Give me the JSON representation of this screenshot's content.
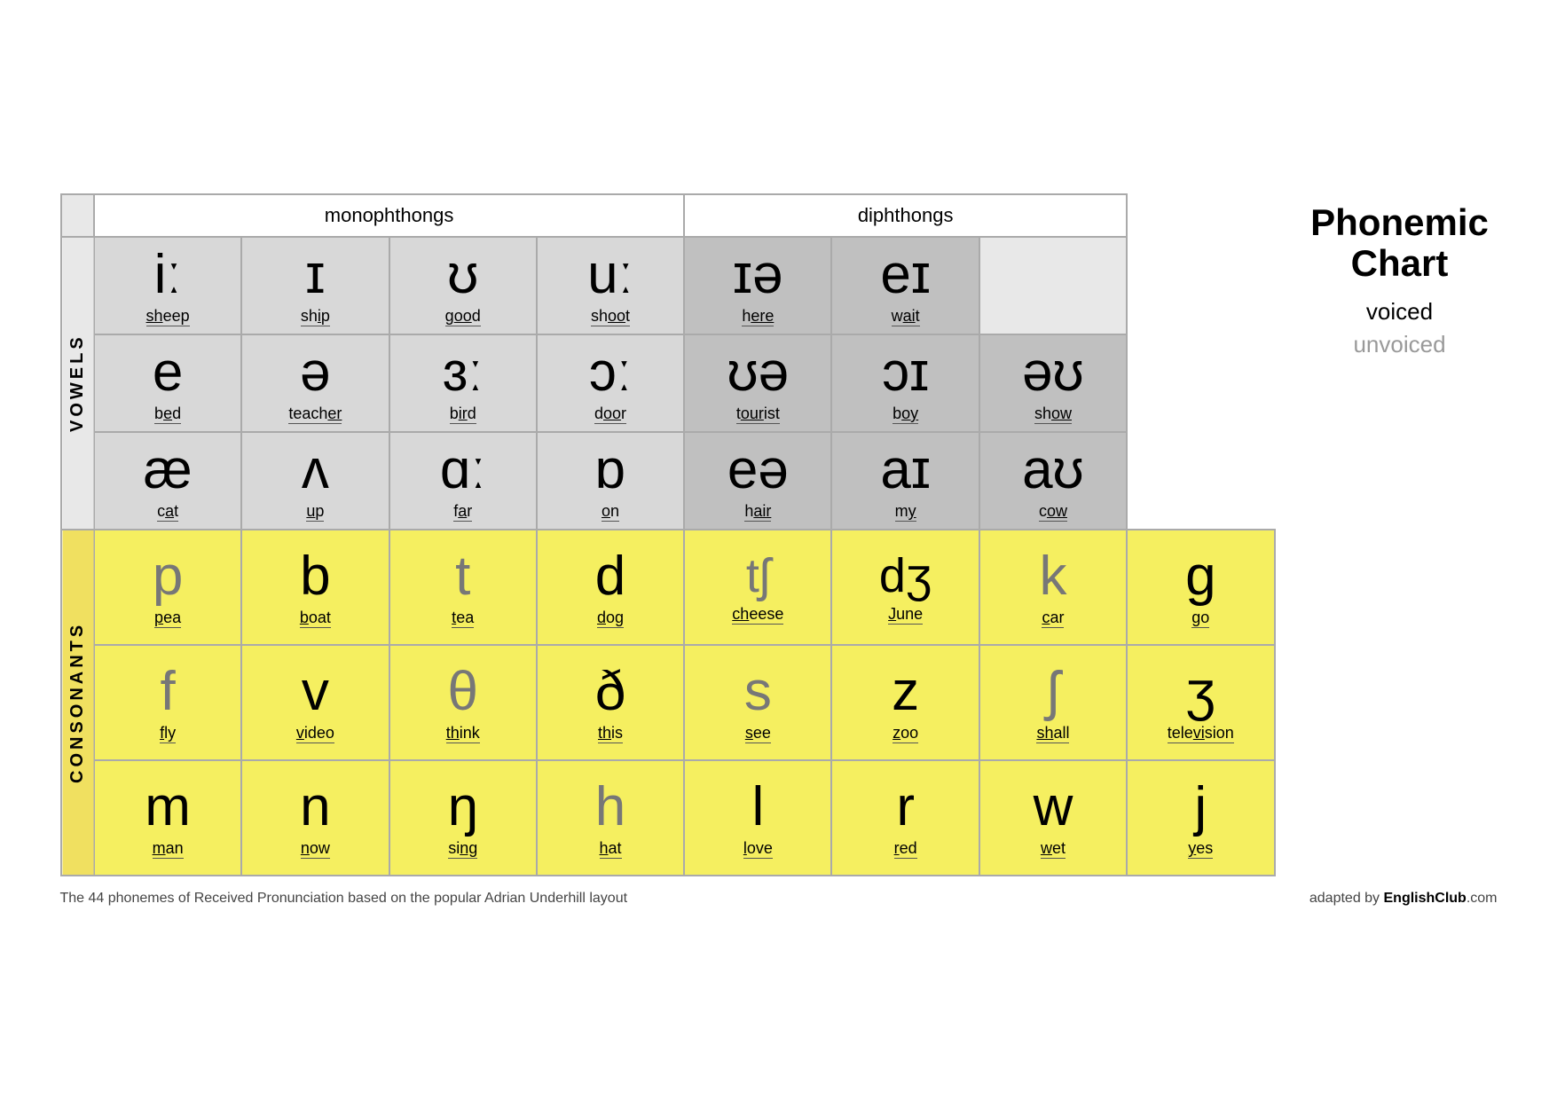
{
  "title": {
    "line1": "Phonemic",
    "line2": "Chart",
    "voiced": "voiced",
    "unvoiced": "unvoiced"
  },
  "headers": {
    "monophthongs": "monophthongs",
    "diphthongs": "diphthongs"
  },
  "section_labels": {
    "vowels": "VOWELS",
    "consonants": "CONSONANTS"
  },
  "vowel_rows": [
    {
      "cells": [
        {
          "symbol": "iː",
          "word": "sheep",
          "underline": "ee"
        },
        {
          "symbol": "ɪ",
          "word": "ship",
          "underline": "i"
        },
        {
          "symbol": "ʊ",
          "word": "good",
          "underline": "oo"
        },
        {
          "symbol": "uː",
          "word": "shoot",
          "underline": "oo"
        }
      ],
      "diphthong_cells": [
        {
          "symbol": "ɪə",
          "word": "here",
          "underline": "ere"
        },
        {
          "symbol": "eɪ",
          "word": "wait",
          "underline": "ai"
        }
      ]
    },
    {
      "cells": [
        {
          "symbol": "e",
          "word": "bed",
          "underline": "e"
        },
        {
          "symbol": "ə",
          "word": "teacher",
          "underline": "er"
        },
        {
          "symbol": "ɜː",
          "word": "bird",
          "underline": "ir"
        },
        {
          "symbol": "ɔː",
          "word": "door",
          "underline": "oo"
        }
      ],
      "diphthong_cells": [
        {
          "symbol": "ʊə",
          "word": "tourist",
          "underline": "our"
        },
        {
          "symbol": "ɔɪ",
          "word": "boy",
          "underline": "oy"
        },
        {
          "symbol": "əʊ",
          "word": "show",
          "underline": "ow"
        }
      ]
    },
    {
      "cells": [
        {
          "symbol": "æ",
          "word": "cat",
          "underline": "a"
        },
        {
          "symbol": "ʌ",
          "word": "up",
          "underline": "u"
        },
        {
          "symbol": "ɑː",
          "word": "far",
          "underline": "a"
        },
        {
          "symbol": "ɒ",
          "word": "on",
          "underline": "o"
        }
      ],
      "diphthong_cells": [
        {
          "symbol": "eə",
          "word": "hair",
          "underline": "air"
        },
        {
          "symbol": "aɪ",
          "word": "my",
          "underline": "y"
        },
        {
          "symbol": "aʊ",
          "word": "cow",
          "underline": "ow"
        }
      ]
    }
  ],
  "consonant_rows": [
    {
      "cells": [
        {
          "symbol": "p",
          "word": "pea",
          "underline": "p",
          "voiced": false
        },
        {
          "symbol": "b",
          "word": "boat",
          "underline": "b",
          "voiced": true
        },
        {
          "symbol": "t",
          "word": "tea",
          "underline": "t",
          "voiced": false
        },
        {
          "symbol": "d",
          "word": "dog",
          "underline": "d",
          "voiced": true
        },
        {
          "symbol": "tʃ",
          "word": "cheese",
          "underline": "ch",
          "voiced": false
        },
        {
          "symbol": "dʒ",
          "word": "June",
          "underline": "J",
          "voiced": true
        },
        {
          "symbol": "k",
          "word": "car",
          "underline": "c",
          "voiced": false
        },
        {
          "symbol": "g",
          "word": "go",
          "underline": "g",
          "voiced": true
        }
      ]
    },
    {
      "cells": [
        {
          "symbol": "f",
          "word": "fly",
          "underline": "f",
          "voiced": false
        },
        {
          "symbol": "v",
          "word": "video",
          "underline": "v",
          "voiced": true
        },
        {
          "symbol": "θ",
          "word": "think",
          "underline": "th",
          "voiced": false
        },
        {
          "symbol": "ð",
          "word": "this",
          "underline": "th",
          "voiced": true
        },
        {
          "symbol": "s",
          "word": "see",
          "underline": "s",
          "voiced": false
        },
        {
          "symbol": "z",
          "word": "zoo",
          "underline": "z",
          "voiced": true
        },
        {
          "symbol": "ʃ",
          "word": "shall",
          "underline": "sh",
          "voiced": false
        },
        {
          "symbol": "ʒ",
          "word": "television",
          "underline": "si",
          "voiced": true
        }
      ]
    },
    {
      "cells": [
        {
          "symbol": "m",
          "word": "man",
          "underline": "m",
          "voiced": true
        },
        {
          "symbol": "n",
          "word": "now",
          "underline": "n",
          "voiced": true
        },
        {
          "symbol": "ŋ",
          "word": "sing",
          "underline": "ng",
          "voiced": true
        },
        {
          "symbol": "h",
          "word": "hat",
          "underline": "h",
          "voiced": false
        },
        {
          "symbol": "l",
          "word": "love",
          "underline": "l",
          "voiced": true
        },
        {
          "symbol": "r",
          "word": "red",
          "underline": "r",
          "voiced": true
        },
        {
          "symbol": "w",
          "word": "wet",
          "underline": "w",
          "voiced": true
        },
        {
          "symbol": "j",
          "word": "yes",
          "underline": "y",
          "voiced": true
        }
      ]
    }
  ],
  "footer": {
    "left": "The 44 phonemes of Received Pronunciation based on the popular Adrian Underhill layout",
    "right_prefix": "adapted by ",
    "right_brand": "EnglishClub",
    "right_suffix": ".com"
  }
}
